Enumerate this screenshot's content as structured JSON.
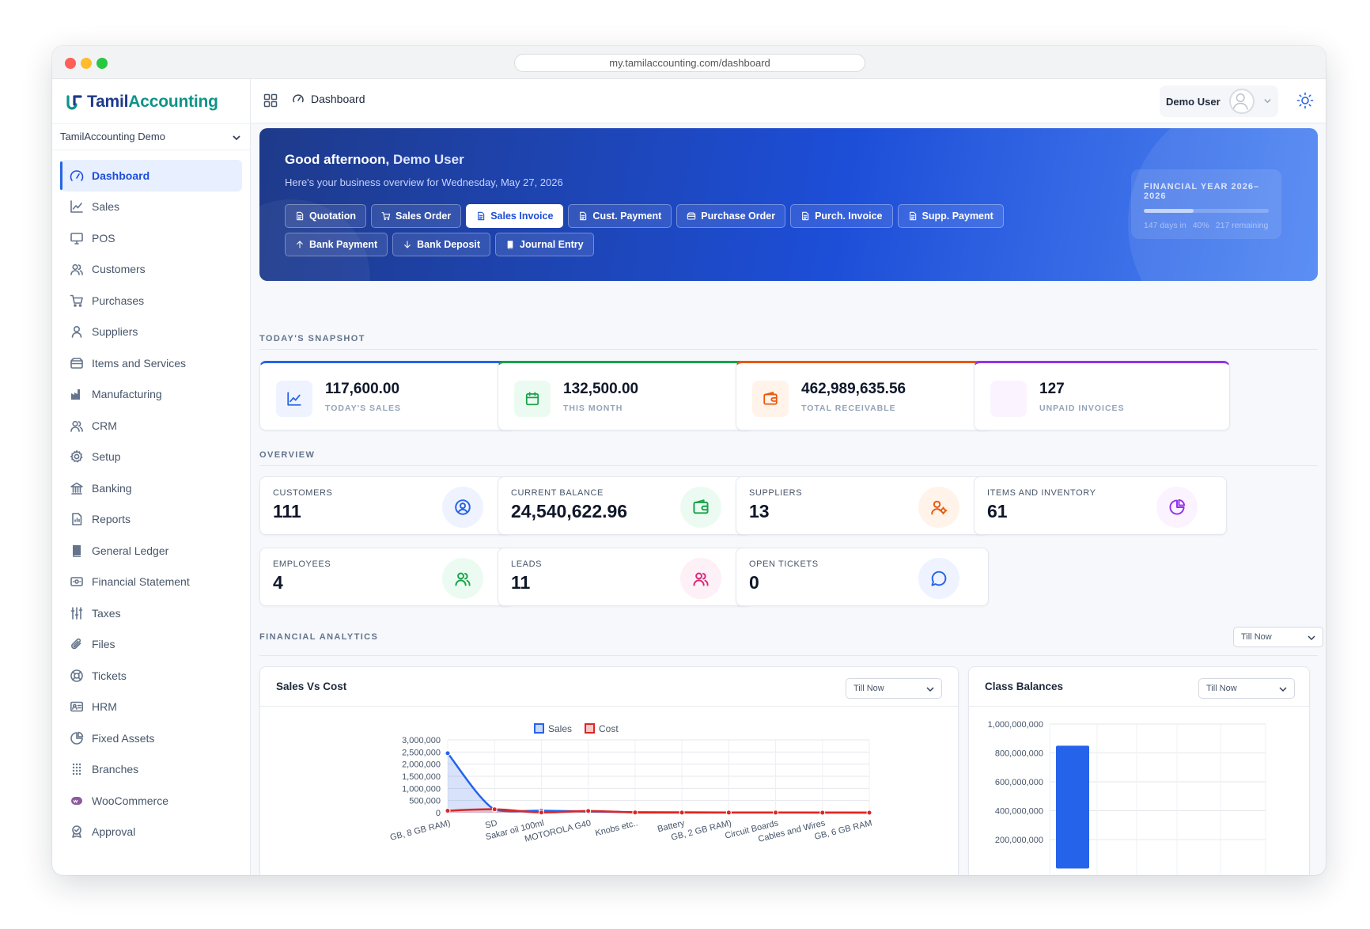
{
  "browser": {
    "url": "my.tamilaccounting.com/dashboard"
  },
  "brand": {
    "logo_text_a": "Tamil",
    "logo_text_b": "Accounting",
    "accent": "#0d9488",
    "primary": "#1e3a8a"
  },
  "company_selector": {
    "value": "TamilAccounting Demo"
  },
  "sidebar": {
    "items": [
      {
        "label": "Dashboard",
        "icon": "gauge-icon",
        "active": true
      },
      {
        "label": "Sales",
        "icon": "line-chart-icon"
      },
      {
        "label": "POS",
        "icon": "monitor-icon"
      },
      {
        "label": "Customers",
        "icon": "users-icon"
      },
      {
        "label": "Purchases",
        "icon": "cart-icon"
      },
      {
        "label": "Suppliers",
        "icon": "user-icon"
      },
      {
        "label": "Items and Services",
        "icon": "box-icon"
      },
      {
        "label": "Manufacturing",
        "icon": "factory-icon"
      },
      {
        "label": "CRM",
        "icon": "users-icon"
      },
      {
        "label": "Setup",
        "icon": "gear-icon"
      },
      {
        "label": "Banking",
        "icon": "bank-icon"
      },
      {
        "label": "Reports",
        "icon": "report-icon"
      },
      {
        "label": "General Ledger",
        "icon": "book-icon"
      },
      {
        "label": "Financial Statement",
        "icon": "statement-icon"
      },
      {
        "label": "Taxes",
        "icon": "sliders-icon"
      },
      {
        "label": "Files",
        "icon": "paperclip-icon"
      },
      {
        "label": "Tickets",
        "icon": "lifebuoy-icon"
      },
      {
        "label": "HRM",
        "icon": "id-card-icon"
      },
      {
        "label": "Fixed Assets",
        "icon": "pie-icon"
      },
      {
        "label": "Branches",
        "icon": "grid-dots-icon"
      },
      {
        "label": "WooCommerce",
        "icon": "woo-icon"
      },
      {
        "label": "Approval",
        "icon": "approval-icon"
      }
    ]
  },
  "topbar": {
    "breadcrumb": "Dashboard",
    "user_name": "Demo User"
  },
  "hero": {
    "greeting": "Good afternoon, ",
    "user": "Demo User",
    "subtitle": "Here's your business overview for Wednesday, May 27, 2026",
    "actions": [
      {
        "label": "Quotation",
        "icon": "doc-icon"
      },
      {
        "label": "Sales Order",
        "icon": "cart-icon"
      },
      {
        "label": "Sales Invoice",
        "icon": "doc-icon",
        "active": true
      },
      {
        "label": "Cust. Payment",
        "icon": "doc-icon"
      },
      {
        "label": "Purchase Order",
        "icon": "box-icon"
      },
      {
        "label": "Purch. Invoice",
        "icon": "doc-icon"
      },
      {
        "label": "Supp. Payment",
        "icon": "doc-icon"
      },
      {
        "label": "Bank Payment",
        "icon": "arrow-up-icon"
      },
      {
        "label": "Bank Deposit",
        "icon": "arrow-down-icon"
      },
      {
        "label": "Journal Entry",
        "icon": "book-icon"
      }
    ],
    "financial_year": {
      "title": "FINANCIAL YEAR 2026–2026",
      "days_in": "147 days in",
      "percent_label": "40%",
      "remaining": "217 remaining",
      "progress": 0.4
    }
  },
  "snapshot": {
    "title": "TODAY'S SNAPSHOT",
    "cards": [
      {
        "value": "117,600.00",
        "label": "TODAY'S SALES",
        "color": "#2563eb",
        "bg": "#eef3ff",
        "icon": "line-chart-icon"
      },
      {
        "value": "132,500.00",
        "label": "THIS MONTH",
        "color": "#16a34a",
        "bg": "#ecfbf1",
        "icon": "calendar-icon"
      },
      {
        "value": "462,989,635.56",
        "label": "TOTAL RECEIVABLE",
        "color": "#ea580c",
        "bg": "#fff3ea",
        "icon": "wallet-icon"
      },
      {
        "value": "127",
        "label": "UNPAID INVOICES",
        "color": "#9333ea",
        "bg": "#fbf3ff",
        "icon": ""
      }
    ]
  },
  "overview": {
    "title": "OVERVIEW",
    "cards": [
      {
        "label": "CUSTOMERS",
        "value": "111",
        "color": "#2563eb",
        "bg": "#eef3ff",
        "icon": "user-circle-icon"
      },
      {
        "label": "CURRENT BALANCE",
        "value": "24,540,622.96",
        "color": "#16a34a",
        "bg": "#ecfbf1",
        "icon": "wallet-icon"
      },
      {
        "label": "SUPPLIERS",
        "value": "13",
        "color": "#ea580c",
        "bg": "#fff3ea",
        "icon": "user-gear-icon"
      },
      {
        "label": "ITEMS AND INVENTORY",
        "value": "61",
        "color": "#9333ea",
        "bg": "#fbf3ff",
        "icon": "pie-icon"
      },
      {
        "label": "EMPLOYEES",
        "value": "4",
        "color": "#16a34a",
        "bg": "#ecfbf1",
        "icon": "users-icon"
      },
      {
        "label": "LEADS",
        "value": "11",
        "color": "#db2777",
        "bg": "#fdf0f6",
        "icon": "users-icon"
      },
      {
        "label": "OPEN TICKETS",
        "value": "0",
        "color": "#2563eb",
        "bg": "#eef3ff",
        "icon": "chat-icon"
      }
    ]
  },
  "analytics": {
    "title": "FINANCIAL ANALYTICS",
    "period": "Till Now",
    "sales_vs_cost": {
      "title": "Sales Vs Cost",
      "period": "Till Now"
    },
    "class_balances": {
      "title": "Class Balances",
      "period": "Till Now"
    }
  },
  "chart_data": [
    {
      "type": "line",
      "title": "Sales Vs Cost",
      "categories": [
        "GB, 8 GB RAM)",
        "SD",
        "Sakar oil 100ml",
        "MOTOROLA G40",
        "Knobs etc..",
        "Battery",
        "GB, 2 GB RAM)",
        "Circuit Boards",
        "Cables and Wires",
        "GB, 6 GB RAM"
      ],
      "series": [
        {
          "name": "Sales",
          "color": "#2563eb",
          "values": [
            2450000,
            120000,
            80000,
            50000,
            20000,
            15000,
            10000,
            10000,
            8000,
            5000
          ]
        },
        {
          "name": "Cost",
          "color": "#dc2626",
          "values": [
            80000,
            140000,
            10000,
            70000,
            10000,
            5000,
            3000,
            3000,
            2000,
            1000
          ]
        }
      ],
      "yticks": [
        "3,000,000",
        "2,500,000",
        "2,000,000",
        "1,500,000",
        "1,000,000",
        "500,000",
        "0"
      ],
      "ylim": [
        0,
        3000000
      ],
      "legend": "top-center",
      "grid": true
    },
    {
      "type": "bar",
      "title": "Class Balances",
      "categories": [
        ""
      ],
      "values": [
        850000000
      ],
      "yticks": [
        "1,000,000,000",
        "800,000,000",
        "600,000,000",
        "400,000,000",
        "200,000,000"
      ],
      "ylim": [
        0,
        1000000000
      ],
      "color": "#2563eb",
      "grid": true
    }
  ]
}
